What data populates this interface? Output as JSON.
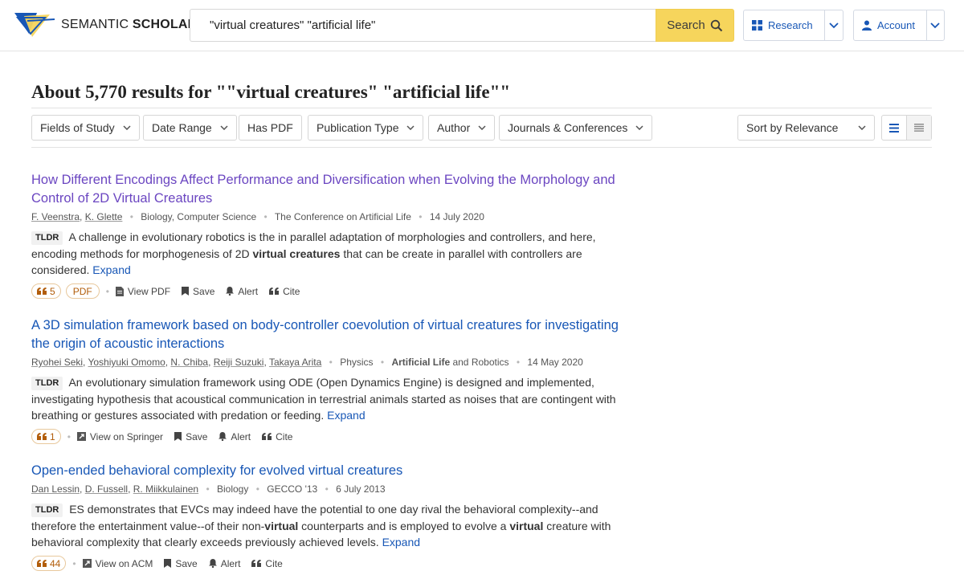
{
  "header": {
    "brand_light": "SEMANTIC ",
    "brand_bold": "SCHOLAR",
    "search_value": "\"virtual creatures\" \"artificial life\"",
    "search_label": "Search",
    "research_label": "Research",
    "account_label": "Account",
    "accent": "#f6d55c",
    "link_color": "#1857b6"
  },
  "results_heading": "About 5,770 results for \"\"virtual creatures\" \"artificial life\"\"",
  "filters": [
    "Fields of Study",
    "Date Range",
    "Has PDF",
    "Publication Type",
    "Author",
    "Journals & Conferences"
  ],
  "sort_label": "Sort by Relevance",
  "tldr_tag": "TLDR",
  "expand_label": "Expand",
  "actions": {
    "save": "Save",
    "alert": "Alert",
    "cite": "Cite",
    "pdf_badge": "PDF"
  },
  "results": [
    {
      "title": "How Different Encodings Affect Performance and Diversification when Evolving the Morphology and Control of 2D Virtual Creatures",
      "authors": [
        "F. Veenstra",
        "K. Glette"
      ],
      "fields": "Biology, Computer Science",
      "venue": "The Conference on Artificial Life",
      "date": "14 July 2020",
      "tldr_parts": [
        "A challenge in evolutionary robotics is the in parallel adaptation of morphologies and controllers, and here, encoding methods for morphogenesis of 2D ",
        "virtual creatures",
        " that can be create in parallel with controllers are considered."
      ],
      "citations": "5",
      "view": "View PDF"
    },
    {
      "title": "A 3D simulation framework based on body-controller coevolution of virtual creatures for investigating the origin of acoustic interactions",
      "authors": [
        "Ryohei Seki",
        "Yoshiyuki Omomo",
        "N. Chiba",
        "Reiji Suzuki",
        "Takaya Arita"
      ],
      "fields": "Physics",
      "venue_bold": "Artificial Life",
      "venue_rest": " and Robotics",
      "date": "14 May 2020",
      "tldr": "An evolutionary simulation framework using ODE (Open Dynamics Engine) is designed and implemented, investigating hypothesis that acoustical communication in terrestrial animals started as noises that are contingent with breathing or gestures associated with predation or feeding.",
      "citations": "1",
      "view": "View on Springer"
    },
    {
      "title": "Open-ended behavioral complexity for evolved virtual creatures",
      "authors": [
        "Dan Lessin",
        "D. Fussell",
        "R. Miikkulainen"
      ],
      "fields": "Biology",
      "venue": "GECCO '13",
      "date": "6 July 2013",
      "tldr_parts": [
        "ES demonstrates that EVCs may indeed have the potential to one day rival the behavioral complexity--and therefore the entertainment value--of their non-",
        "virtual",
        " counterparts and is employed to evolve a ",
        "virtual",
        " creature with behavioral complexity that clearly exceeds previously achieved levels."
      ],
      "citations": "44",
      "view": "View on ACM"
    }
  ]
}
